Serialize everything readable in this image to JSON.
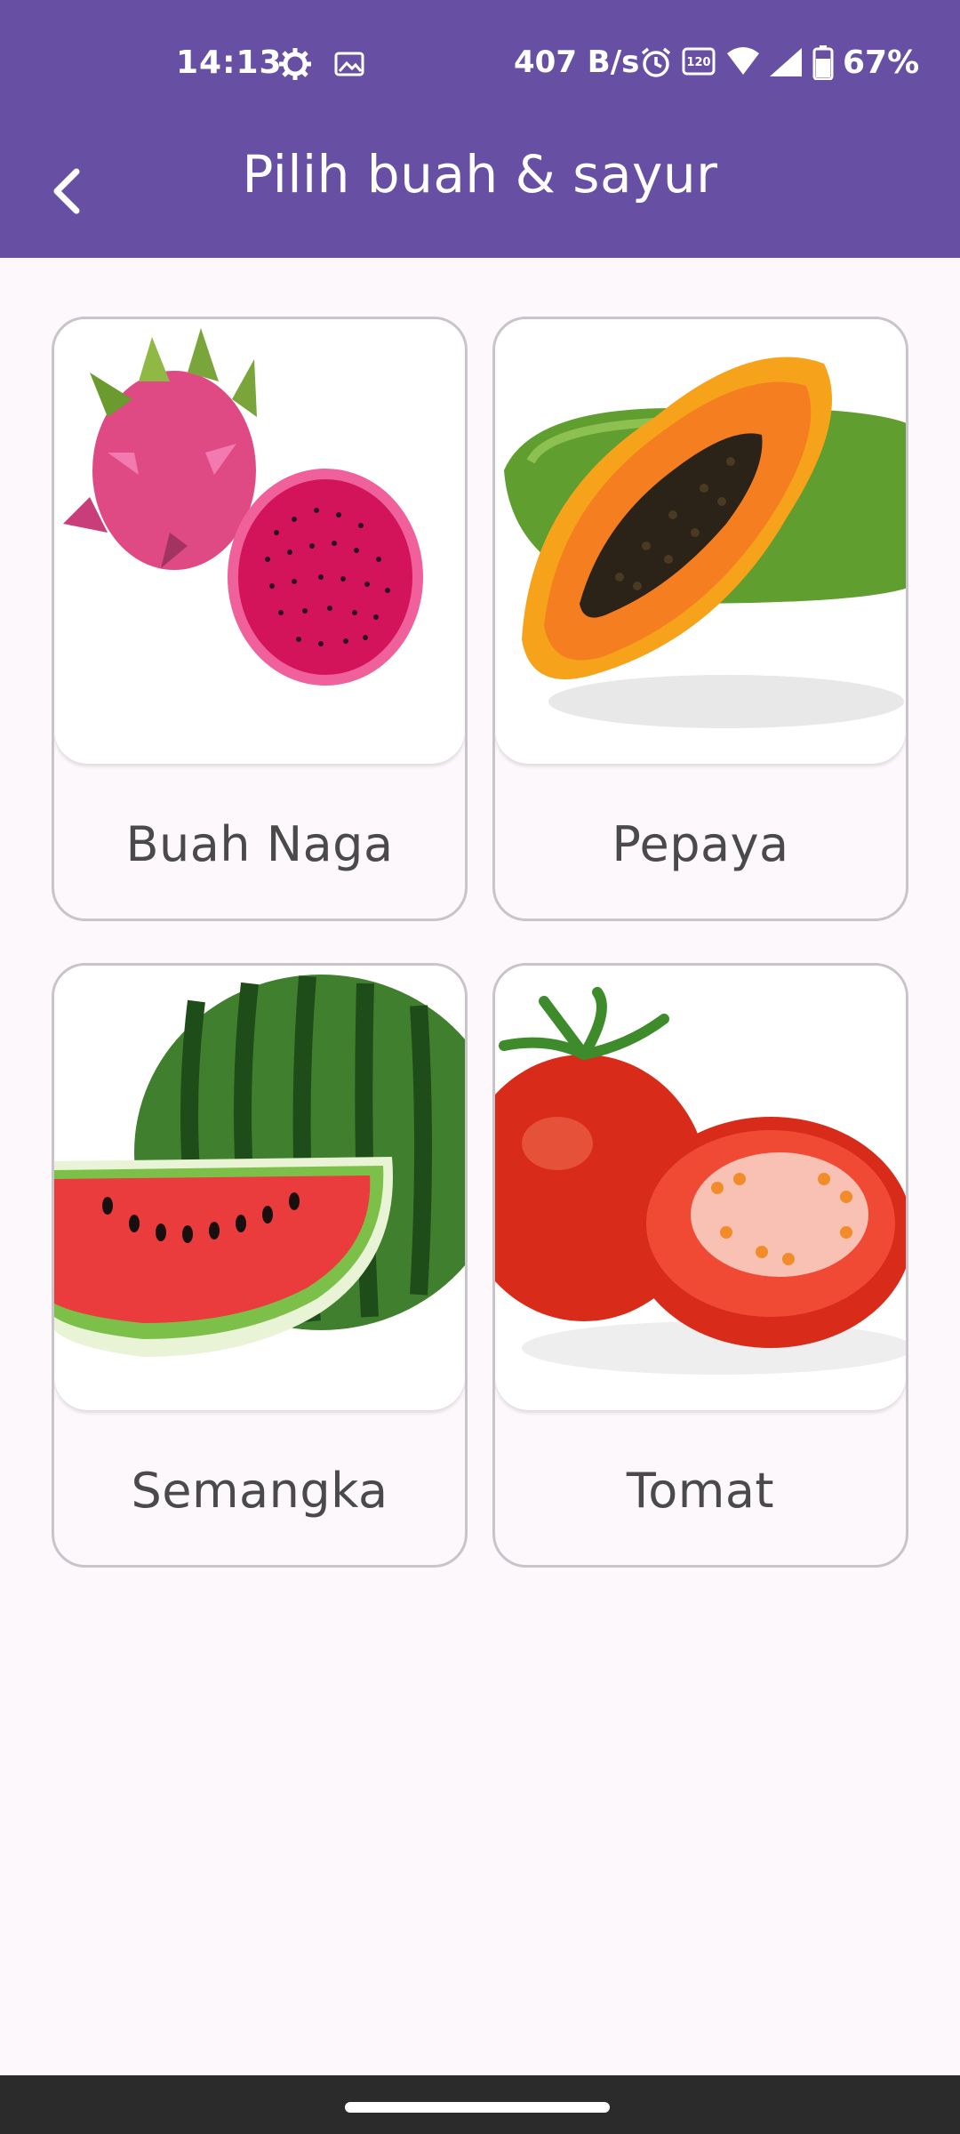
{
  "status_bar": {
    "time": "14:13",
    "net_speed": "407 B/s",
    "battery": "67%",
    "icons": [
      "settings-icon",
      "gallery-icon",
      "alarm-icon",
      "refresh-rate-120hz-icon",
      "wifi-icon",
      "signal-icon",
      "battery-icon"
    ]
  },
  "app_bar": {
    "title": "Pilih buah & sayur",
    "back_icon": "back-arrow-icon",
    "background": "#6750a4"
  },
  "items": [
    {
      "label": "Buah Naga",
      "image": "dragon-fruit-image"
    },
    {
      "label": "Pepaya",
      "image": "papaya-image"
    },
    {
      "label": "Semangka",
      "image": "watermelon-image"
    },
    {
      "label": "Tomat",
      "image": "tomato-image"
    }
  ]
}
